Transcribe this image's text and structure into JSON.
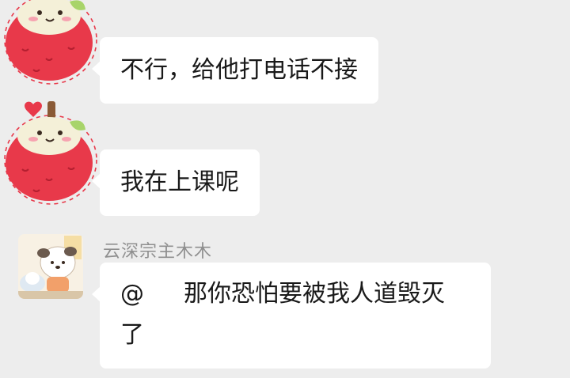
{
  "messages": [
    {
      "avatar": "apple-avatar-icon",
      "text": "不行，给他打电话不接"
    },
    {
      "avatar": "apple-avatar-icon",
      "text": "我在上课呢"
    },
    {
      "avatar": "puppy-avatar-icon",
      "sender": "云深宗主木木",
      "mention": "@",
      "text_line1": "那你恐怕要被我人道毁灭",
      "text_line2": "了"
    }
  ],
  "colors": {
    "background": "#ededed",
    "bubble": "#ffffff",
    "text": "#191919",
    "sender": "#8f8f8f",
    "apple_red": "#e8394a"
  }
}
